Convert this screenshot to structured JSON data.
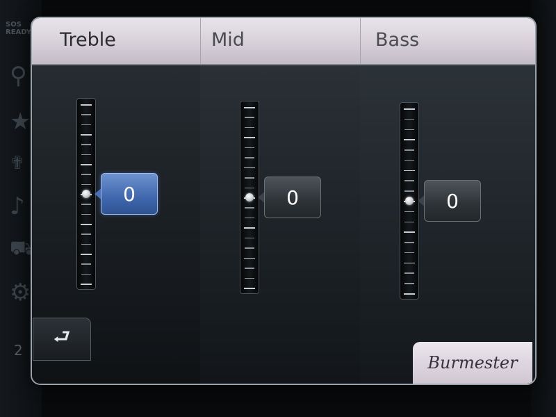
{
  "status": {
    "sos_line1": "SOS",
    "sos_line2": "READY"
  },
  "sidebar_bottom_text": "2",
  "right_edge_text": "0",
  "equalizer": {
    "bands": [
      {
        "label": "Treble",
        "value": "0",
        "level": 0.5,
        "selected": true
      },
      {
        "label": "Mid",
        "value": "0",
        "level": 0.5,
        "selected": false
      },
      {
        "label": "Bass",
        "value": "0",
        "level": 0.5,
        "selected": false
      }
    ]
  },
  "back_button": {
    "icon": "back-arrow-icon",
    "glyph": "⮐"
  },
  "brand": {
    "name": "Burmester"
  },
  "colors": {
    "selected_value": "#3f67ad",
    "inactive_value": "#2d3236",
    "header": "#d7d0d9"
  }
}
